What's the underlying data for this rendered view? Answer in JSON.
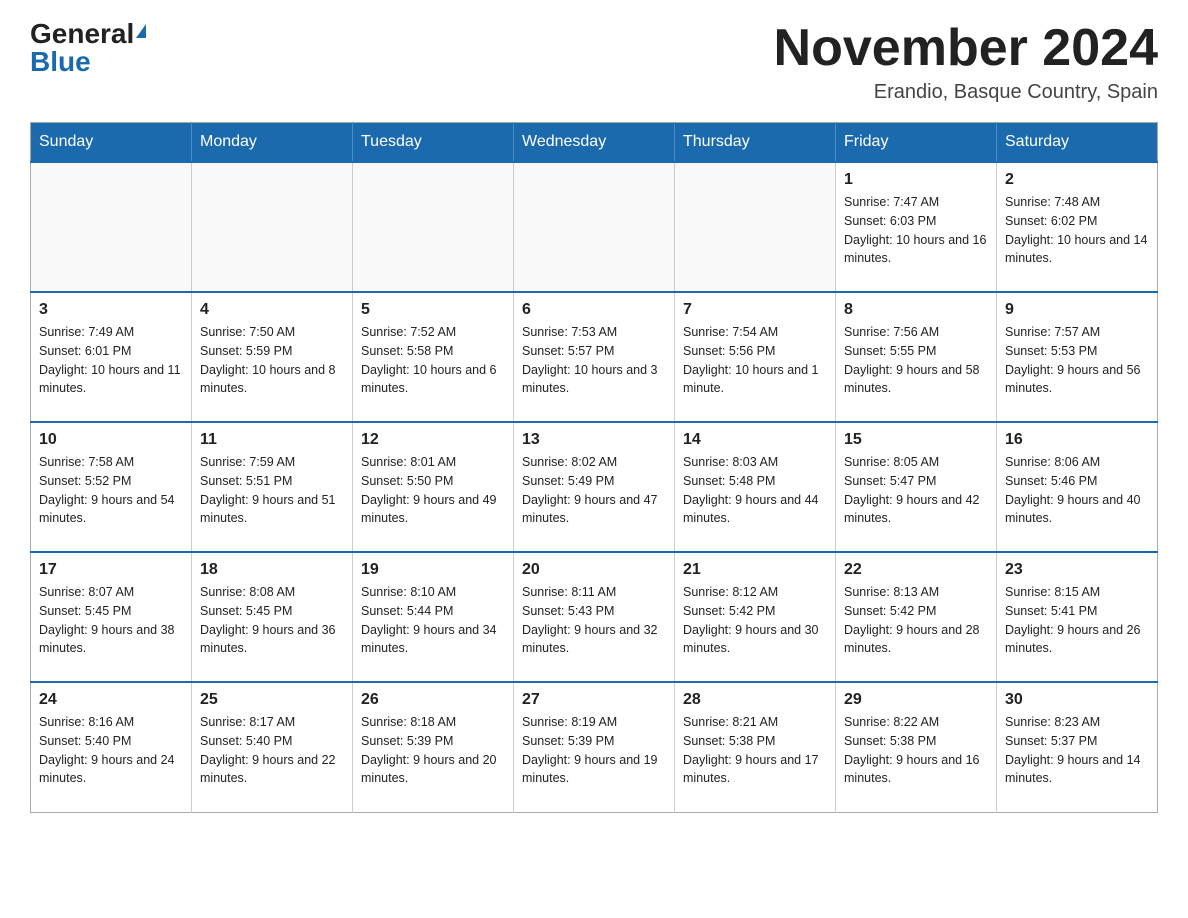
{
  "logo": {
    "general": "General",
    "blue": "Blue"
  },
  "title": "November 2024",
  "subtitle": "Erandio, Basque Country, Spain",
  "weekdays": [
    "Sunday",
    "Monday",
    "Tuesday",
    "Wednesday",
    "Thursday",
    "Friday",
    "Saturday"
  ],
  "rows": [
    [
      {
        "day": "",
        "info": ""
      },
      {
        "day": "",
        "info": ""
      },
      {
        "day": "",
        "info": ""
      },
      {
        "day": "",
        "info": ""
      },
      {
        "day": "",
        "info": ""
      },
      {
        "day": "1",
        "info": "Sunrise: 7:47 AM\nSunset: 6:03 PM\nDaylight: 10 hours and 16 minutes."
      },
      {
        "day": "2",
        "info": "Sunrise: 7:48 AM\nSunset: 6:02 PM\nDaylight: 10 hours and 14 minutes."
      }
    ],
    [
      {
        "day": "3",
        "info": "Sunrise: 7:49 AM\nSunset: 6:01 PM\nDaylight: 10 hours and 11 minutes."
      },
      {
        "day": "4",
        "info": "Sunrise: 7:50 AM\nSunset: 5:59 PM\nDaylight: 10 hours and 8 minutes."
      },
      {
        "day": "5",
        "info": "Sunrise: 7:52 AM\nSunset: 5:58 PM\nDaylight: 10 hours and 6 minutes."
      },
      {
        "day": "6",
        "info": "Sunrise: 7:53 AM\nSunset: 5:57 PM\nDaylight: 10 hours and 3 minutes."
      },
      {
        "day": "7",
        "info": "Sunrise: 7:54 AM\nSunset: 5:56 PM\nDaylight: 10 hours and 1 minute."
      },
      {
        "day": "8",
        "info": "Sunrise: 7:56 AM\nSunset: 5:55 PM\nDaylight: 9 hours and 58 minutes."
      },
      {
        "day": "9",
        "info": "Sunrise: 7:57 AM\nSunset: 5:53 PM\nDaylight: 9 hours and 56 minutes."
      }
    ],
    [
      {
        "day": "10",
        "info": "Sunrise: 7:58 AM\nSunset: 5:52 PM\nDaylight: 9 hours and 54 minutes."
      },
      {
        "day": "11",
        "info": "Sunrise: 7:59 AM\nSunset: 5:51 PM\nDaylight: 9 hours and 51 minutes."
      },
      {
        "day": "12",
        "info": "Sunrise: 8:01 AM\nSunset: 5:50 PM\nDaylight: 9 hours and 49 minutes."
      },
      {
        "day": "13",
        "info": "Sunrise: 8:02 AM\nSunset: 5:49 PM\nDaylight: 9 hours and 47 minutes."
      },
      {
        "day": "14",
        "info": "Sunrise: 8:03 AM\nSunset: 5:48 PM\nDaylight: 9 hours and 44 minutes."
      },
      {
        "day": "15",
        "info": "Sunrise: 8:05 AM\nSunset: 5:47 PM\nDaylight: 9 hours and 42 minutes."
      },
      {
        "day": "16",
        "info": "Sunrise: 8:06 AM\nSunset: 5:46 PM\nDaylight: 9 hours and 40 minutes."
      }
    ],
    [
      {
        "day": "17",
        "info": "Sunrise: 8:07 AM\nSunset: 5:45 PM\nDaylight: 9 hours and 38 minutes."
      },
      {
        "day": "18",
        "info": "Sunrise: 8:08 AM\nSunset: 5:45 PM\nDaylight: 9 hours and 36 minutes."
      },
      {
        "day": "19",
        "info": "Sunrise: 8:10 AM\nSunset: 5:44 PM\nDaylight: 9 hours and 34 minutes."
      },
      {
        "day": "20",
        "info": "Sunrise: 8:11 AM\nSunset: 5:43 PM\nDaylight: 9 hours and 32 minutes."
      },
      {
        "day": "21",
        "info": "Sunrise: 8:12 AM\nSunset: 5:42 PM\nDaylight: 9 hours and 30 minutes."
      },
      {
        "day": "22",
        "info": "Sunrise: 8:13 AM\nSunset: 5:42 PM\nDaylight: 9 hours and 28 minutes."
      },
      {
        "day": "23",
        "info": "Sunrise: 8:15 AM\nSunset: 5:41 PM\nDaylight: 9 hours and 26 minutes."
      }
    ],
    [
      {
        "day": "24",
        "info": "Sunrise: 8:16 AM\nSunset: 5:40 PM\nDaylight: 9 hours and 24 minutes."
      },
      {
        "day": "25",
        "info": "Sunrise: 8:17 AM\nSunset: 5:40 PM\nDaylight: 9 hours and 22 minutes."
      },
      {
        "day": "26",
        "info": "Sunrise: 8:18 AM\nSunset: 5:39 PM\nDaylight: 9 hours and 20 minutes."
      },
      {
        "day": "27",
        "info": "Sunrise: 8:19 AM\nSunset: 5:39 PM\nDaylight: 9 hours and 19 minutes."
      },
      {
        "day": "28",
        "info": "Sunrise: 8:21 AM\nSunset: 5:38 PM\nDaylight: 9 hours and 17 minutes."
      },
      {
        "day": "29",
        "info": "Sunrise: 8:22 AM\nSunset: 5:38 PM\nDaylight: 9 hours and 16 minutes."
      },
      {
        "day": "30",
        "info": "Sunrise: 8:23 AM\nSunset: 5:37 PM\nDaylight: 9 hours and 14 minutes."
      }
    ]
  ]
}
